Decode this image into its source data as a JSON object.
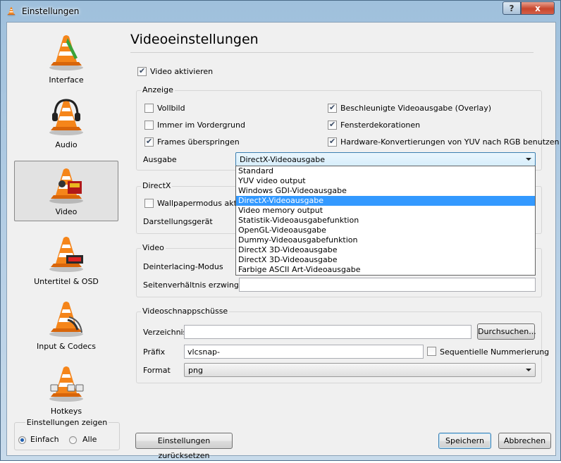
{
  "window": {
    "title": "Einstellungen",
    "help_glyph": "?",
    "close_glyph": "x"
  },
  "sidebar": {
    "items": [
      {
        "label": "Interface"
      },
      {
        "label": "Audio"
      },
      {
        "label": "Video",
        "selected": true
      },
      {
        "label": "Untertitel & OSD"
      },
      {
        "label": "Input & Codecs"
      },
      {
        "label": "Hotkeys"
      }
    ],
    "show_settings": {
      "caption": "Einstellungen zeigen",
      "simple": "Einfach",
      "all": "Alle",
      "selected": "Einfach"
    }
  },
  "page": {
    "title": "Videoeinstellungen",
    "enable_video": {
      "label": "Video aktivieren",
      "checked": true
    }
  },
  "display": {
    "caption": "Anzeige",
    "fullscreen": {
      "label": "Vollbild",
      "checked": false
    },
    "always_on_top": {
      "label": "Immer im Vordergrund",
      "checked": false
    },
    "skip_frames": {
      "label": "Frames überspringen",
      "checked": true
    },
    "overlay": {
      "label": "Beschleunigte Videoausgabe (Overlay)",
      "checked": true
    },
    "decorations": {
      "label": "Fensterdekorationen",
      "checked": true
    },
    "hw_yuv": {
      "label": "Hardware-Konvertierungen von YUV nach RGB benutzen",
      "checked": true
    },
    "output_label": "Ausgabe",
    "output_value": "DirectX-Videoausgabe",
    "output_options": [
      "Standard",
      "YUV video output",
      "Windows GDI-Videoausgabe",
      "DirectX-Videoausgabe",
      "Video memory output",
      "Statistik-Videoausgabefunktion",
      "OpenGL-Videoausgabe",
      "Dummy-Videoausgabefunktion",
      "DirectX 3D-Videoausgabe",
      "DirectX 3D-Videoausgabe",
      "Farbige ASCII Art-Videoausgabe"
    ],
    "output_selected_index": 3
  },
  "directx": {
    "caption": "DirectX",
    "wallpaper": {
      "label": "Wallpapermodus aktivi",
      "checked": false
    },
    "device_label": "Darstellungsgerät"
  },
  "video": {
    "caption": "Video",
    "deinterlace_label": "Deinterlacing-Modus",
    "aspect_label": "Seitenverhältnis erzwingen",
    "aspect_value": ""
  },
  "snapshots": {
    "caption": "Videoschnappschüsse",
    "dir_label": "Verzeichnis",
    "dir_value": "",
    "browse_label": "Durchsuchen...",
    "prefix_label": "Präfix",
    "prefix_value": "vlcsnap-",
    "sequential": {
      "label": "Sequentielle Nummerierung",
      "checked": false
    },
    "format_label": "Format",
    "format_value": "png"
  },
  "footer": {
    "reset": "Einstellungen zurücksetzen",
    "save": "Speichern",
    "cancel": "Abbrechen"
  },
  "colors": {
    "cone_orange": "#f07c0a",
    "selection": "#3399ff"
  }
}
